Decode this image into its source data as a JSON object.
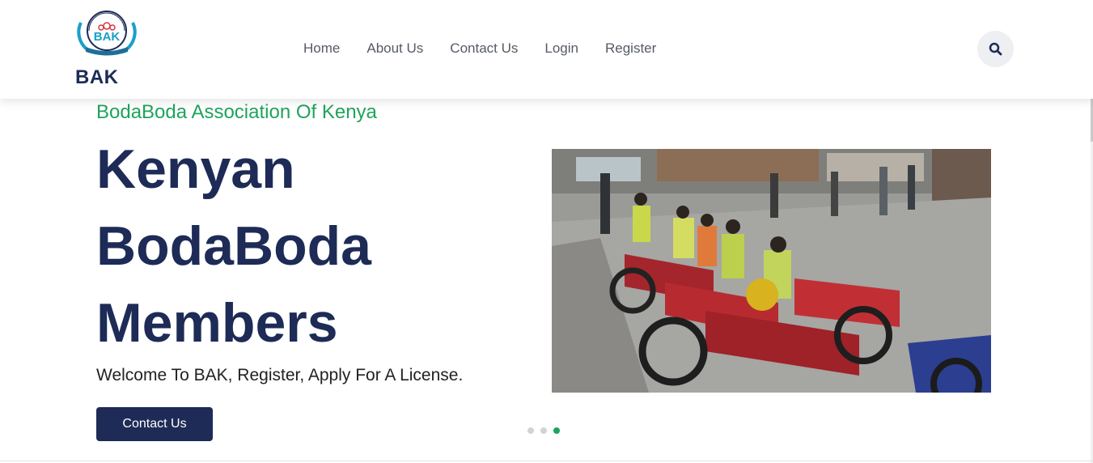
{
  "brand": {
    "name": "BAK",
    "logo_text": "BAK",
    "logo_ring_text": "Boda Boda Association of Kenya"
  },
  "nav": {
    "items": [
      "Home",
      "About Us",
      "Contact Us",
      "Login",
      "Register"
    ]
  },
  "hero": {
    "subtitle": "BodaBoda Association Of Kenya",
    "title_lines": [
      "Kenyan",
      "BodaBoda",
      "Members"
    ],
    "text": "Welcome To BAK, Register, Apply For A License.",
    "button_label": "Contact Us"
  },
  "carousel": {
    "slide_count": 3,
    "active_index": 2
  },
  "colors": {
    "primary": "#1d2b56",
    "accent": "#1fa35c"
  },
  "icons": {
    "search": "search-icon"
  }
}
